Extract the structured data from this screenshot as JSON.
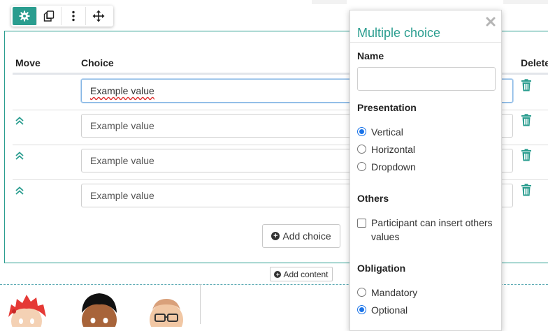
{
  "toolbar": {
    "items": [
      {
        "icon": "gear-icon",
        "active": true
      },
      {
        "icon": "copy-icon",
        "active": false
      },
      {
        "icon": "more-vertical-icon",
        "active": false
      },
      {
        "icon": "move-arrows-icon",
        "active": false
      }
    ]
  },
  "table": {
    "headers": {
      "move": "Move",
      "choice": "Choice",
      "delete": "Delete"
    },
    "rows": [
      {
        "value": "Example value",
        "focused": true,
        "movable": false
      },
      {
        "value": "Example value",
        "focused": false,
        "movable": true
      },
      {
        "value": "Example value",
        "focused": false,
        "movable": true
      },
      {
        "value": "Example value",
        "focused": false,
        "movable": true
      }
    ],
    "add_choice_label": "Add choice"
  },
  "add_content_label": "Add content",
  "panel": {
    "title": "Multiple choice",
    "name_label": "Name",
    "name_value": "",
    "presentation_label": "Presentation",
    "presentation_options": [
      {
        "label": "Vertical",
        "checked": true
      },
      {
        "label": "Horizontal",
        "checked": false
      },
      {
        "label": "Dropdown",
        "checked": false
      }
    ],
    "others_label": "Others",
    "others_checkbox_label": "Participant can insert others values",
    "others_checked": false,
    "obligation_label": "Obligation",
    "obligation_options": [
      {
        "label": "Mandatory",
        "checked": false
      },
      {
        "label": "Optional",
        "checked": true
      }
    ]
  },
  "colors": {
    "accent": "#2a9d8f",
    "radio": "#1a73e8",
    "delete": "#2a9d8f"
  }
}
